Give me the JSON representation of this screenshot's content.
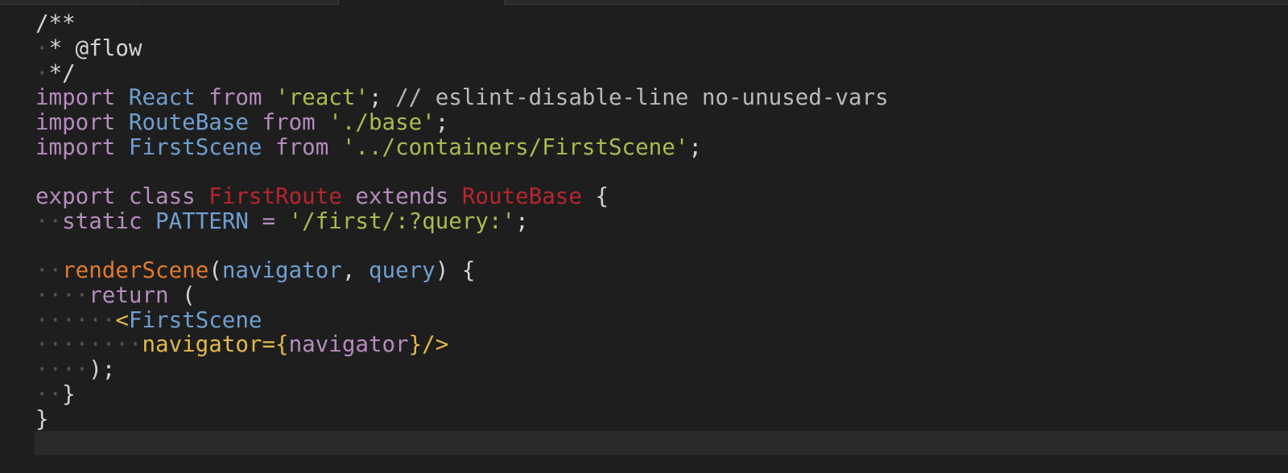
{
  "editor": {
    "language": "javascript",
    "lines": [
      [
        {
          "t": "/**",
          "c": "t-comment"
        }
      ],
      [
        {
          "t": "·",
          "c": "ws"
        },
        {
          "t": "* @flow",
          "c": "t-comment"
        }
      ],
      [
        {
          "t": "·",
          "c": "ws"
        },
        {
          "t": "*/",
          "c": "t-comment"
        }
      ],
      [
        {
          "t": "import",
          "c": "t-kw"
        },
        {
          "t": " ",
          "c": "t-plain"
        },
        {
          "t": "React",
          "c": "t-id"
        },
        {
          "t": " ",
          "c": "t-plain"
        },
        {
          "t": "from",
          "c": "t-kw"
        },
        {
          "t": " ",
          "c": "t-plain"
        },
        {
          "t": "'react'",
          "c": "t-str"
        },
        {
          "t": "; ",
          "c": "t-plain"
        },
        {
          "t": "// eslint-disable-line no-unused-vars",
          "c": "t-linecomment"
        }
      ],
      [
        {
          "t": "import",
          "c": "t-kw"
        },
        {
          "t": " ",
          "c": "t-plain"
        },
        {
          "t": "RouteBase",
          "c": "t-id"
        },
        {
          "t": " ",
          "c": "t-plain"
        },
        {
          "t": "from",
          "c": "t-kw"
        },
        {
          "t": " ",
          "c": "t-plain"
        },
        {
          "t": "'./base'",
          "c": "t-str"
        },
        {
          "t": ";",
          "c": "t-plain"
        }
      ],
      [
        {
          "t": "import",
          "c": "t-kw"
        },
        {
          "t": " ",
          "c": "t-plain"
        },
        {
          "t": "FirstScene",
          "c": "t-id"
        },
        {
          "t": " ",
          "c": "t-plain"
        },
        {
          "t": "from",
          "c": "t-kw"
        },
        {
          "t": " ",
          "c": "t-plain"
        },
        {
          "t": "'../containers/FirstScene'",
          "c": "t-str"
        },
        {
          "t": ";",
          "c": "t-plain"
        }
      ],
      [],
      [
        {
          "t": "export",
          "c": "t-kw"
        },
        {
          "t": " ",
          "c": "t-plain"
        },
        {
          "t": "class",
          "c": "t-kw"
        },
        {
          "t": " ",
          "c": "t-plain"
        },
        {
          "t": "FirstRoute",
          "c": "t-class"
        },
        {
          "t": " ",
          "c": "t-plain"
        },
        {
          "t": "extends",
          "c": "t-kw"
        },
        {
          "t": " ",
          "c": "t-plain"
        },
        {
          "t": "RouteBase",
          "c": "t-class"
        },
        {
          "t": " {",
          "c": "t-plain"
        }
      ],
      [
        {
          "t": "··",
          "c": "ws"
        },
        {
          "t": "static",
          "c": "t-kw"
        },
        {
          "t": " ",
          "c": "t-plain"
        },
        {
          "t": "PATTERN",
          "c": "t-id"
        },
        {
          "t": " ",
          "c": "t-plain"
        },
        {
          "t": "=",
          "c": "t-kw"
        },
        {
          "t": " ",
          "c": "t-plain"
        },
        {
          "t": "'/first/:?query:'",
          "c": "t-str"
        },
        {
          "t": ";",
          "c": "t-plain"
        }
      ],
      [],
      [
        {
          "t": "··",
          "c": "ws"
        },
        {
          "t": "renderScene",
          "c": "t-fn"
        },
        {
          "t": "(",
          "c": "t-plain"
        },
        {
          "t": "navigator",
          "c": "t-id"
        },
        {
          "t": ", ",
          "c": "t-plain"
        },
        {
          "t": "query",
          "c": "t-id"
        },
        {
          "t": ") {",
          "c": "t-plain"
        }
      ],
      [
        {
          "t": "····",
          "c": "ws"
        },
        {
          "t": "return",
          "c": "t-kw"
        },
        {
          "t": " (",
          "c": "t-plain"
        }
      ],
      [
        {
          "t": "······",
          "c": "ws"
        },
        {
          "t": "<",
          "c": "t-tag"
        },
        {
          "t": "FirstScene",
          "c": "t-id"
        }
      ],
      [
        {
          "t": "········",
          "c": "ws"
        },
        {
          "t": "navigator",
          "c": "t-attr"
        },
        {
          "t": "={",
          "c": "t-tag"
        },
        {
          "t": "navigator",
          "c": "t-var"
        },
        {
          "t": "}/>",
          "c": "t-tag"
        }
      ],
      [
        {
          "t": "····",
          "c": "ws"
        },
        {
          "t": ");",
          "c": "t-plain"
        }
      ],
      [
        {
          "t": "··",
          "c": "ws"
        },
        {
          "t": "}",
          "c": "t-plain"
        }
      ],
      [
        {
          "t": "}",
          "c": "t-plain"
        }
      ]
    ]
  }
}
